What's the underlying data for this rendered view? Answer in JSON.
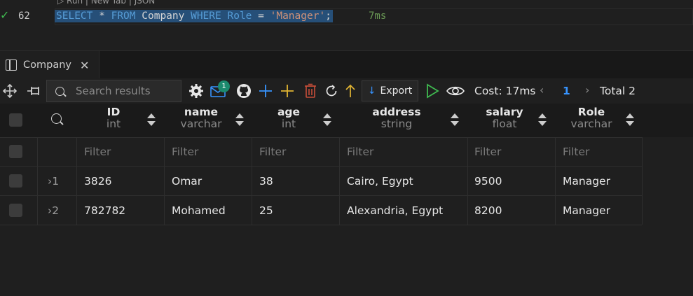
{
  "editor": {
    "codelens": "Run | New Tab | JSON",
    "line_number": "62",
    "sql": {
      "kw_select": "SELECT",
      "star": "*",
      "kw_from": "FROM",
      "table": "Company",
      "kw_where": "WHERE",
      "column": "Role",
      "eq": "=",
      "value": "'Manager'",
      "semi": ";"
    },
    "timing": "7ms"
  },
  "tab": {
    "label": "Company"
  },
  "toolbar": {
    "search_placeholder": "Search results",
    "notification_count": "1",
    "export_label": "Export",
    "cost": "Cost: 17ms",
    "page": "1",
    "total": "Total 2"
  },
  "colors": {
    "accent": "#3794ff",
    "success": "#3fb950",
    "badge": "#1c8a6e",
    "add": "#3794ff",
    "plus_yellow": "#e2b533",
    "delete": "#c74e39",
    "play": "#3fb950"
  },
  "table": {
    "columns": [
      {
        "name": "ID",
        "type": "int"
      },
      {
        "name": "name",
        "type": "varchar"
      },
      {
        "name": "age",
        "type": "int"
      },
      {
        "name": "address",
        "type": "string"
      },
      {
        "name": "salary",
        "type": "float"
      },
      {
        "name": "Role",
        "type": "varchar"
      }
    ],
    "filter_placeholder": "Filter",
    "rows": [
      {
        "index": "1",
        "cells": [
          "3826",
          "Omar",
          "38",
          "Cairo, Egypt",
          "9500",
          "Manager"
        ]
      },
      {
        "index": "2",
        "cells": [
          "782782",
          "Mohamed",
          "25",
          "Alexandria, Egypt",
          "8200",
          "Manager"
        ]
      }
    ]
  }
}
